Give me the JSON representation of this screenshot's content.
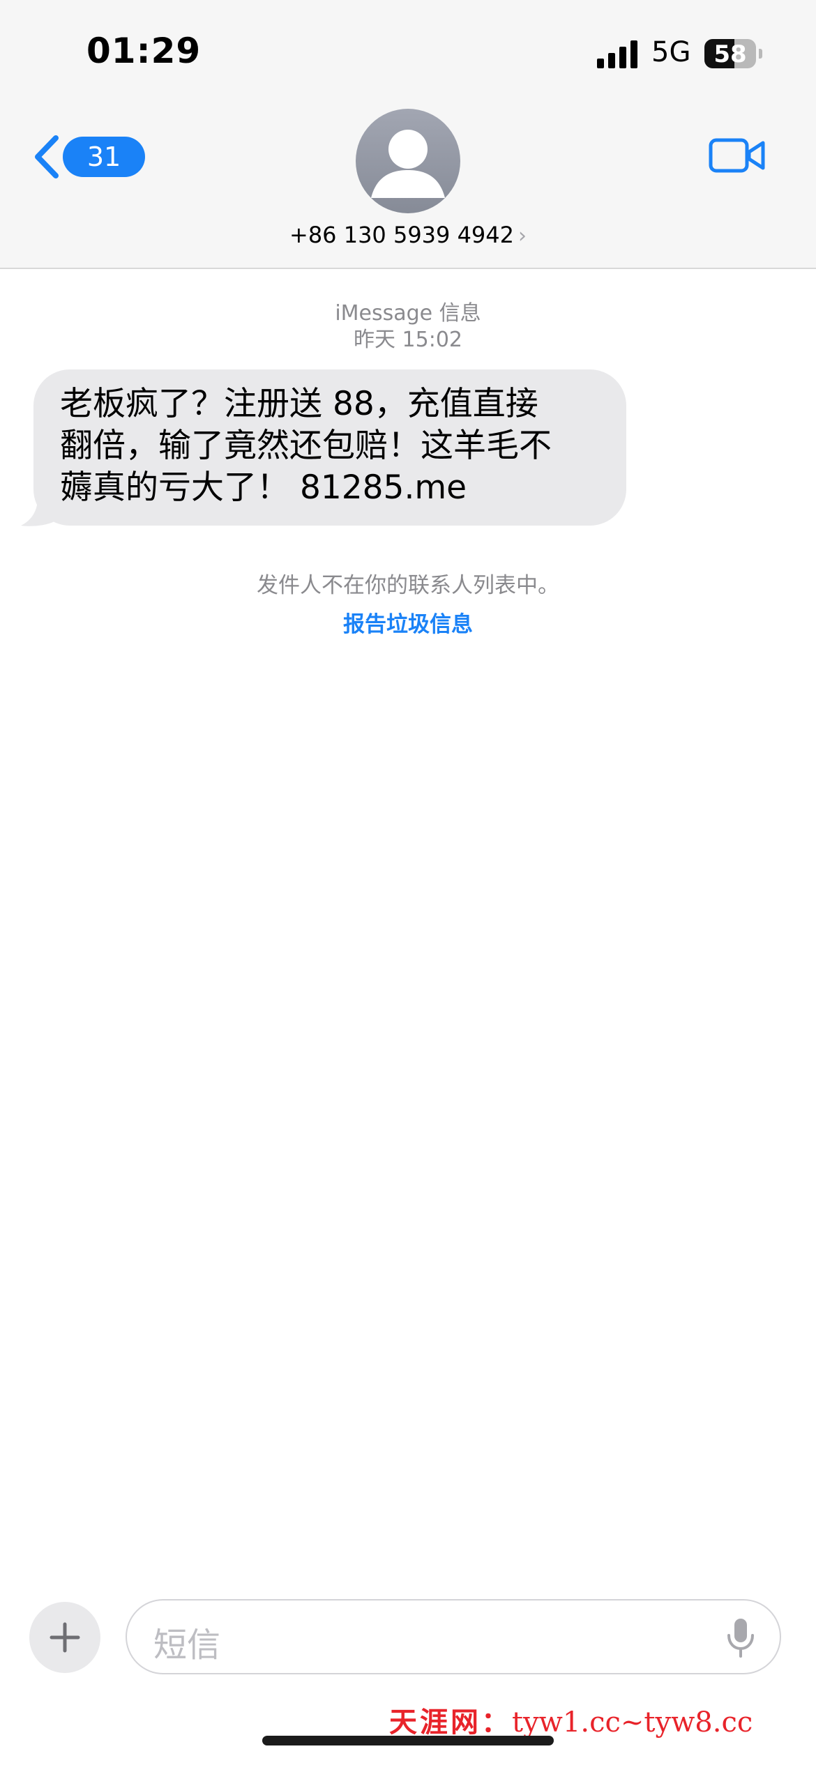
{
  "status_bar": {
    "time": "01:29",
    "network": "5G",
    "battery": "58",
    "battery_level": 0.58
  },
  "nav": {
    "back_count": "31",
    "contact_number": "+86 130 5939 4942",
    "contact_chevron": "›"
  },
  "thread": {
    "service": "iMessage 信息",
    "timestamp": "昨天 15:02",
    "messages": [
      {
        "lines": [
          "老板疯了？注册送 88，充值直接",
          "翻倍，输了竟然还包赔！这羊毛不",
          "薅真的亏大了！ 81285.me"
        ]
      }
    ],
    "unknown_sender_note": "发件人不在你的联系人列表中。",
    "report_link": "报告垃圾信息"
  },
  "composer": {
    "placeholder": "短信",
    "plus_label": "+"
  },
  "watermark": {
    "site_name": "天涯网：",
    "urls": "tyw1.cc~tyw8.cc"
  },
  "icons": {
    "back": "chevron-left-icon",
    "video": "video-camera-icon",
    "mic": "microphone-icon",
    "signal": "cellular-signal-icon",
    "avatar": "person-placeholder-icon"
  },
  "colors": {
    "accent": "#1a82f7",
    "bubble": "#e9e9eb",
    "header_bg": "#f6f6f6",
    "watermark": "#e8232a"
  }
}
